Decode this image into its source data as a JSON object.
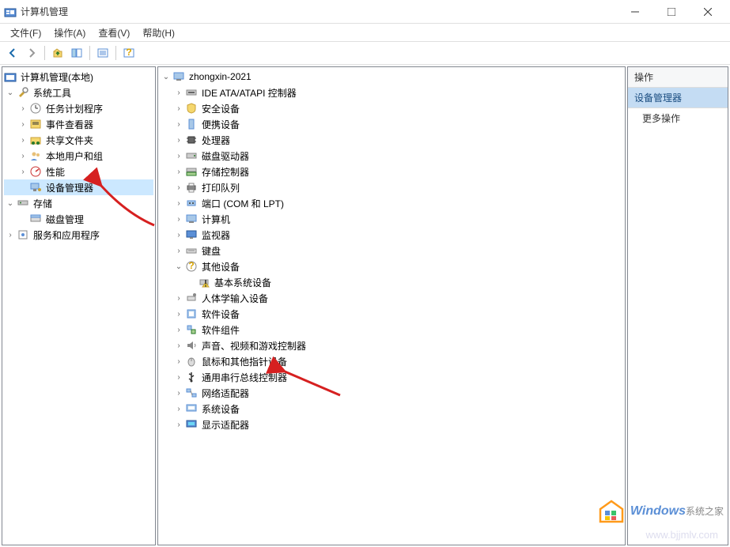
{
  "title": "计算机管理",
  "menu": {
    "file": "文件(F)",
    "action": "操作(A)",
    "view": "查看(V)",
    "help": "帮助(H)"
  },
  "left_tree": {
    "root": "计算机管理(本地)",
    "system_tools": "系统工具",
    "task_scheduler": "任务计划程序",
    "event_viewer": "事件查看器",
    "shared_folders": "共享文件夹",
    "local_users": "本地用户和组",
    "performance": "性能",
    "device_manager": "设备管理器",
    "storage": "存储",
    "disk_mgmt": "磁盘管理",
    "services": "服务和应用程序"
  },
  "mid_tree": {
    "root": "zhongxin-2021",
    "ide": "IDE ATA/ATAPI 控制器",
    "security": "安全设备",
    "portable": "便携设备",
    "cpu": "处理器",
    "disk_drives": "磁盘驱动器",
    "storage_ctrl": "存储控制器",
    "print_queue": "打印队列",
    "ports": "端口 (COM 和 LPT)",
    "computer": "计算机",
    "monitor": "监视器",
    "keyboard": "键盘",
    "other": "其他设备",
    "base_system": "基本系统设备",
    "hid": "人体学输入设备",
    "software_dev": "软件设备",
    "software_comp": "软件组件",
    "sound": "声音、视频和游戏控制器",
    "mouse": "鼠标和其他指针设备",
    "usb": "通用串行总线控制器",
    "network": "网络适配器",
    "system_dev": "系统设备",
    "display": "显示适配器"
  },
  "actions": {
    "header": "操作",
    "section": "设备管理器",
    "more": "更多操作"
  },
  "branding": {
    "logo_main": "Windows",
    "logo_sub": "系统之家",
    "watermark": "www.bjjmlv.com"
  }
}
